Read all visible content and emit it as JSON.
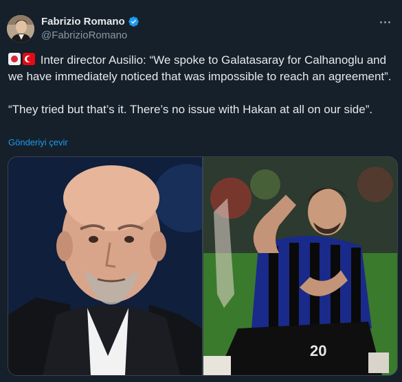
{
  "author": {
    "display_name": "Fabrizio Romano",
    "handle": "@FabrizioRomano",
    "verified": true,
    "avatar_icon": "profile-photo"
  },
  "tweet": {
    "line1": "Inter director Ausilio: “We spoke to Galatasaray for Calhanoglu and we have immediately noticed that was impossible to reach an agreement”.",
    "line2": "“They tried but that’s it. There’s no issue with Hakan at all on our side”.",
    "flags": [
      "japan-flag-icon",
      "turkey-flag-icon"
    ],
    "translate_label": "Gönderiyi çevir"
  },
  "media": {
    "images": [
      {
        "name": "ausilio-photo"
      },
      {
        "name": "calhanoglu-celebration-photo"
      }
    ]
  },
  "colors": {
    "background": "#15202b",
    "link": "#1d9bf0",
    "verified": "#1d9bf0",
    "secondary_text": "#8b98a5"
  }
}
